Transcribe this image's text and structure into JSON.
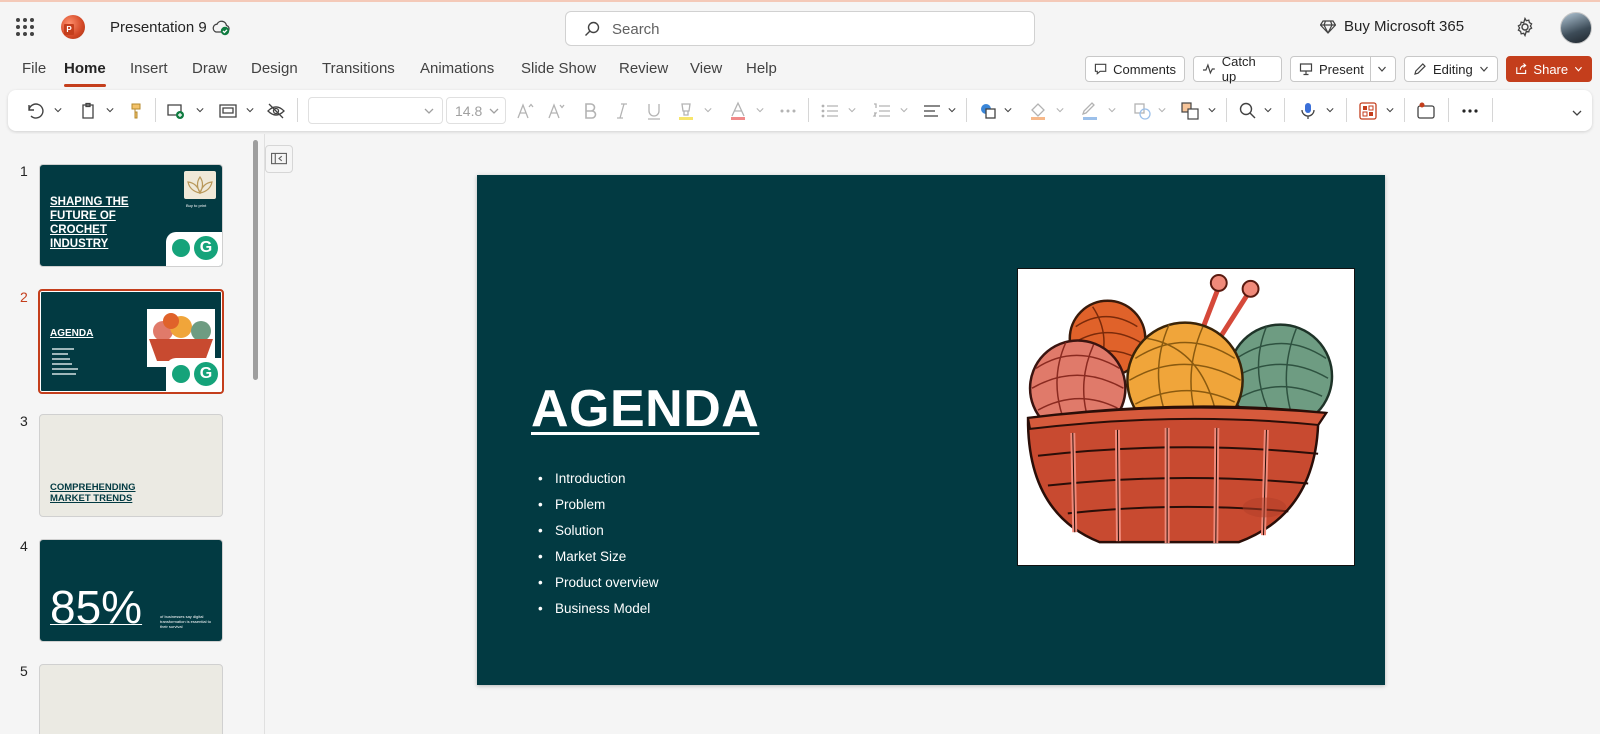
{
  "app": {
    "doc_title": "Presentation 9",
    "search_placeholder": "Search",
    "buy_label": "Buy Microsoft 365"
  },
  "tabs": [
    "File",
    "Home",
    "Insert",
    "Draw",
    "Design",
    "Transitions",
    "Animations",
    "Slide Show",
    "Review",
    "View",
    "Help"
  ],
  "active_tab": "Home",
  "ribbon_buttons": {
    "comments": "Comments",
    "catch_up": "Catch up",
    "present": "Present",
    "editing": "Editing",
    "share": "Share"
  },
  "toolbar": {
    "font_size": "14.8"
  },
  "colors": {
    "accent": "#c43e1c",
    "slide_bg": "#023a42"
  },
  "thumbnails": [
    {
      "num": "1",
      "title_lines": [
        "SHAPING THE",
        "FUTURE OF",
        "CROCHET",
        "INDUSTRY"
      ],
      "logo_caption": "Buy to print"
    },
    {
      "num": "2",
      "title": "AGENDA"
    },
    {
      "num": "3",
      "title_lines": [
        "COMPREHENDING",
        "MARKET TRENDS"
      ]
    },
    {
      "num": "4",
      "stat": "85%",
      "caption": "of businesses say digital transformation is essential to their survival"
    },
    {
      "num": "5"
    }
  ],
  "slide": {
    "title": "AGENDA",
    "bullets": [
      "Introduction",
      "Problem",
      "Solution",
      "Market Size",
      "Product overview",
      "Business Model"
    ]
  }
}
